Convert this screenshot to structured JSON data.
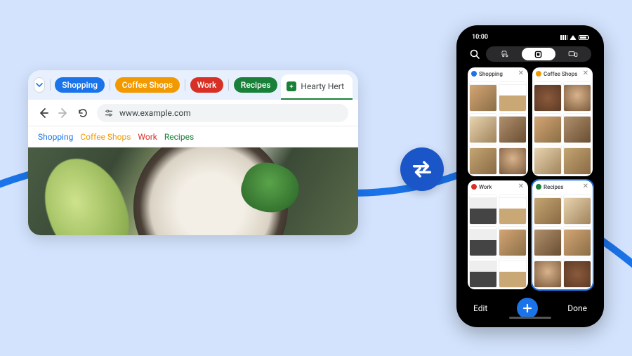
{
  "desktop": {
    "groups": [
      {
        "label": "Shopping",
        "color_class": "pill-blue"
      },
      {
        "label": "Coffee Shops",
        "color_class": "pill-orange"
      },
      {
        "label": "Work",
        "color_class": "pill-red"
      },
      {
        "label": "Recipes",
        "color_class": "pill-green"
      }
    ],
    "active_tab_title": "Hearty Hert",
    "url": "www.example.com",
    "bookmarks": [
      {
        "label": "Shopping",
        "class": "bm-blue"
      },
      {
        "label": "Coffee Shops",
        "class": "bm-orange"
      },
      {
        "label": "Work",
        "class": "bm-red"
      },
      {
        "label": "Recipes",
        "class": "bm-green"
      }
    ]
  },
  "phone": {
    "time": "10:00",
    "groups": [
      {
        "label": "Shopping",
        "dot": "dot-blue"
      },
      {
        "label": "Coffee Shops",
        "dot": "dot-orange"
      },
      {
        "label": "Work",
        "dot": "dot-red"
      },
      {
        "label": "Recipes",
        "dot": "dot-green",
        "selected": true
      }
    ],
    "bottom": {
      "edit": "Edit",
      "done": "Done"
    }
  }
}
